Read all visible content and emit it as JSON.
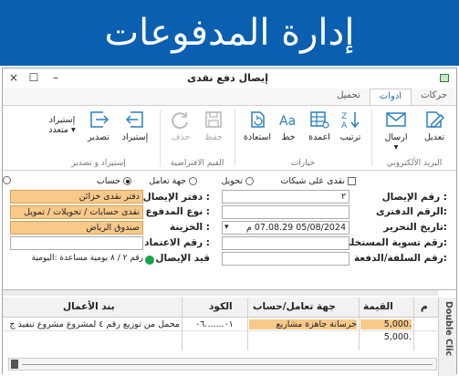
{
  "banner": {
    "title": "إدارة المدفوعات"
  },
  "window": {
    "title": "إيصال دفع نقدى",
    "controls": {
      "close": "×",
      "maximize": "☐",
      "minimize": "–"
    }
  },
  "tabs": [
    {
      "label": "حركات",
      "active": false
    },
    {
      "label": "ادوات",
      "active": true
    },
    {
      "label": "تحميل",
      "active": false
    }
  ],
  "ribbon": {
    "buttons": {
      "edit": "تعديل",
      "send": "ارسال",
      "send_dropdown": "▾",
      "rearrange": "ترتيب",
      "columns": "اعمدة",
      "font": "خط",
      "restore": "استعادة",
      "save": "حفظ",
      "delete": "حذف",
      "import": "إستيراد",
      "export": "تصدير",
      "multi_import_line1": "إستيراد",
      "multi_import_line2": "متعدد ▾"
    },
    "groups": {
      "email": "البريد الألكتروني",
      "options": "خيارات",
      "default_values": "القيم الافتراضية",
      "import_export": "إستيراد و تصدير"
    }
  },
  "form": {
    "checkbox_cheques": "نقدى على شيكات",
    "radio_transfer": "تحويل",
    "radio_deal": "جهة تعامل",
    "radio_account": "حساب",
    "labels": {
      "receipt_no": "رقم الإيصال :",
      "book_no": "الرقم الدفترى:",
      "edit_date": "تاريخ التحرير:",
      "extraction_no": "رقم تسوية المستخلص:",
      "advance_no": "رقم السلفة/الدفعة:",
      "receipt_book": "دفتر الإيصال :",
      "payment_type": "نوع المدفوع :",
      "treasury": "الخزينة :",
      "approval_no": "رقم الاعتماد :",
      "receipt_entry": "قيد الإيصال"
    },
    "values": {
      "receipt_no": "٢",
      "book_no": "",
      "edit_date": "05/08/2024 07.08.29 م",
      "extraction_no": "",
      "advance_no": "",
      "receipt_book": "دفتر نقدى خزائن",
      "payment_type": "نقدى حسابات / تحويلات / تمويل",
      "treasury": "صندوق الرياض",
      "approval_no": "",
      "receipt_entry": "رقم ٢ / ٨ يومية مساعدة :اليومية"
    }
  },
  "grid": {
    "headers": {
      "index": "م",
      "value": "القيمة",
      "deal_account": "جهة تعامل/حساب",
      "code": "الكود",
      "item": "بند الأعمال"
    },
    "rows": [
      {
        "value": "5,000.",
        "deal_account": "خرسانة جاهزة مشاريع",
        "code": "٠١.......٠٦",
        "item": "محمل من توزيع رقم ٤ لمشروع مشروع تنفيذ ج"
      }
    ],
    "total": "5,000.",
    "side_panel": "Double Clic"
  },
  "colors": {
    "banner": "#0a5fb0",
    "highlight": "#f9c98a",
    "accent_tab": "#2b6cb0",
    "status_green": "#1aa34a"
  }
}
